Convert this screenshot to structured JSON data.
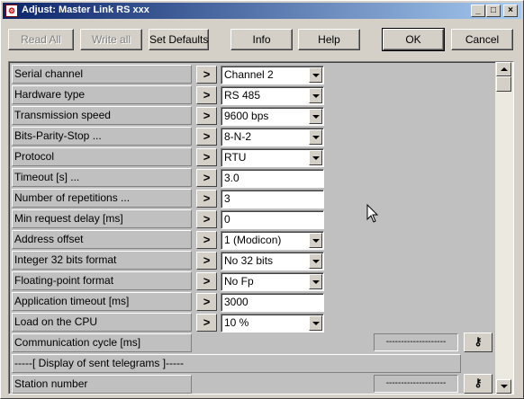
{
  "window": {
    "title": "Adjust: Master Link RS xxx",
    "app_icon": "document-icon",
    "minimize_glyph": "_",
    "maximize_glyph": "□",
    "close_glyph": "×"
  },
  "toolbar": {
    "read_all": "Read All",
    "write_all": "Write all",
    "set_defaults": "Set Defaults",
    "info": "Info",
    "help": "Help",
    "ok": "OK",
    "cancel": "Cancel"
  },
  "params": [
    {
      "label": "Serial channel",
      "value": "Channel 2",
      "kind": "combo"
    },
    {
      "label": "Hardware type",
      "value": "RS 485",
      "kind": "combo"
    },
    {
      "label": "Transmission speed",
      "value": "9600 bps",
      "kind": "combo"
    },
    {
      "label": "Bits-Parity-Stop ...",
      "value": "8-N-2",
      "kind": "combo"
    },
    {
      "label": "Protocol",
      "value": "RTU",
      "kind": "combo"
    },
    {
      "label": "Timeout [s] ...",
      "value": "3.0",
      "kind": "text"
    },
    {
      "label": "Number of repetitions ...",
      "value": "3",
      "kind": "text"
    },
    {
      "label": "Min request delay [ms]",
      "value": "0",
      "kind": "text"
    },
    {
      "label": "Address offset",
      "value": "1 (Modicon)",
      "kind": "combo"
    },
    {
      "label": "Integer 32 bits format",
      "value": "No 32 bits",
      "kind": "combo"
    },
    {
      "label": "Floating-point format",
      "value": "No Fp",
      "kind": "combo"
    },
    {
      "label": "Application timeout [ms]",
      "value": "3000",
      "kind": "text"
    },
    {
      "label": "Load on the CPU",
      "value": "10 %",
      "kind": "combo"
    }
  ],
  "arrow_glyph": ">",
  "communication_cycle": {
    "label": "Communication cycle [ms]",
    "status": "--------------------",
    "key_icon": "key-icon"
  },
  "telegrams_header": "-----[ Display of sent telegrams ]-----",
  "station_number": {
    "label": "Station number",
    "status": "--------------------",
    "key_icon": "key-icon"
  }
}
